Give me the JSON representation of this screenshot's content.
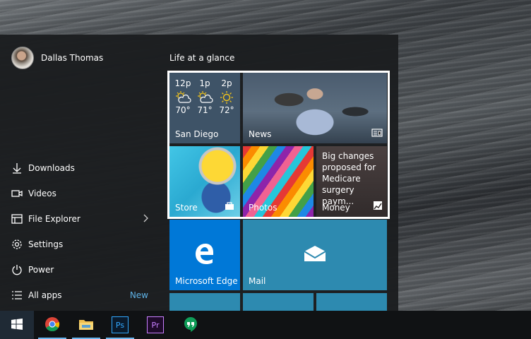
{
  "user": {
    "name": "Dallas Thomas"
  },
  "menu": {
    "items": [
      {
        "label": "Downloads",
        "icon": "downloads-icon"
      },
      {
        "label": "Videos",
        "icon": "videos-icon"
      },
      {
        "label": "File Explorer",
        "icon": "file-explorer-icon"
      },
      {
        "label": "Settings",
        "icon": "settings-icon"
      },
      {
        "label": "Power",
        "icon": "power-icon"
      },
      {
        "label": "All apps",
        "icon": "all-apps-icon"
      }
    ],
    "all_apps_badge": "New"
  },
  "tiles": {
    "group_title": "Life at a glance",
    "weather": {
      "location": "San Diego",
      "forecast": [
        {
          "time": "12p",
          "temp": "70°",
          "icon": "partly-sunny-icon"
        },
        {
          "time": "1p",
          "temp": "71°",
          "icon": "partly-sunny-icon"
        },
        {
          "time": "2p",
          "temp": "72°",
          "icon": "sunny-icon"
        }
      ]
    },
    "news": {
      "label": "News"
    },
    "store": {
      "label": "Store"
    },
    "photos": {
      "label": "Photos"
    },
    "money": {
      "label": "Money",
      "headline": "Big changes proposed for Medicare surgery paym..."
    },
    "edge": {
      "label": "Microsoft Edge"
    },
    "mail": {
      "label": "Mail"
    }
  },
  "taskbar": {
    "apps": [
      {
        "name": "start-button"
      },
      {
        "name": "chrome-icon"
      },
      {
        "name": "file-explorer-icon"
      },
      {
        "name": "photoshop-icon",
        "text": "Ps"
      },
      {
        "name": "premiere-icon",
        "text": "Pr"
      },
      {
        "name": "hangouts-icon"
      }
    ]
  },
  "colors": {
    "accent": "#0078d7",
    "tile_teal": "#2d8ab0",
    "weather_tile": "#3e5367",
    "new_badge": "#5eb2e6",
    "menu_bg": "#1c1e20"
  }
}
